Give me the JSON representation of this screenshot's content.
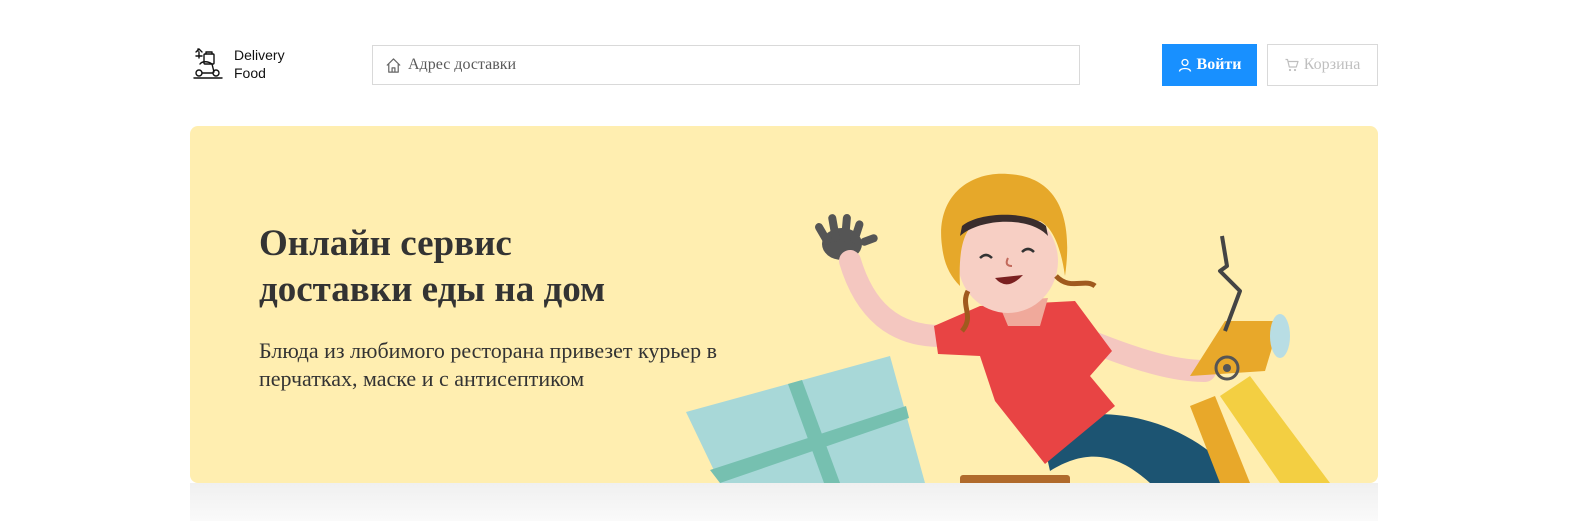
{
  "header": {
    "logo": {
      "line1": "Delivery",
      "line2": "Food",
      "icon": "courier-logo-icon"
    },
    "search": {
      "placeholder": "Адрес доставки",
      "icon": "home-icon"
    },
    "login_button": {
      "label": "Войти",
      "icon": "user-icon"
    },
    "cart_button": {
      "label": "Корзина",
      "icon": "cart-icon"
    }
  },
  "hero": {
    "title_line1": "Онлайн сервис",
    "title_line2": "доставки еды на дом",
    "text": "Блюда из любимого ресторана привезет курьер в перчатках, маске и с антисептиком",
    "illustration": "courier-on-scooter-illustration"
  },
  "colors": {
    "primary": "#1890ff",
    "hero_background": "#ffeeb0",
    "text": "#333333",
    "border": "#d9d9d9"
  }
}
